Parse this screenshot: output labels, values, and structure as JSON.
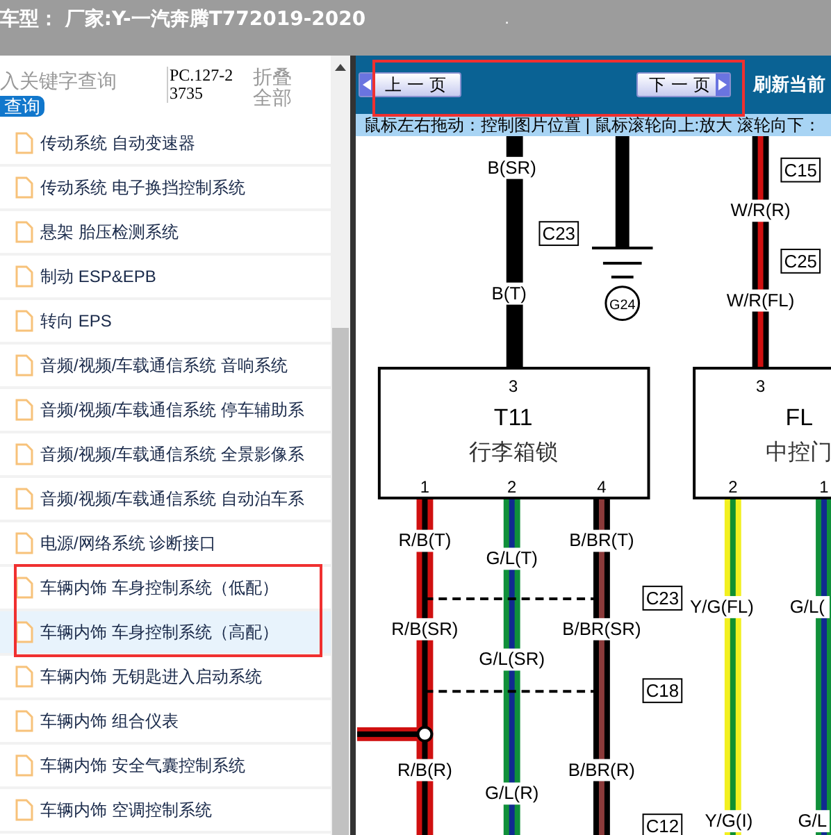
{
  "header": {
    "title": "车型： 厂家:Y-一汽奔腾T772019-2020",
    "mark": "."
  },
  "sidebar": {
    "search": {
      "placeholder": "入关键字查询"
    },
    "search_button": "查询",
    "code": "PC.127-23735",
    "collapse_all": "折叠全部",
    "items": [
      {
        "label": "传动系统 自动变速器",
        "selected": false
      },
      {
        "label": "传动系统 电子换挡控制系统",
        "selected": false
      },
      {
        "label": "悬架 胎压检测系统",
        "selected": false
      },
      {
        "label": "制动 ESP&EPB",
        "selected": false
      },
      {
        "label": "转向 EPS",
        "selected": false
      },
      {
        "label": "音频/视频/车载通信系统 音响系统",
        "selected": false
      },
      {
        "label": "音频/视频/车载通信系统 停车辅助系",
        "selected": false
      },
      {
        "label": "音频/视频/车载通信系统 全景影像系",
        "selected": false
      },
      {
        "label": "音频/视频/车载通信系统 自动泊车系",
        "selected": false
      },
      {
        "label": "电源/网络系统 诊断接口",
        "selected": false
      },
      {
        "label": "车辆内饰 车身控制系统（低配）",
        "selected": false
      },
      {
        "label": "车辆内饰 车身控制系统（高配）",
        "selected": true
      },
      {
        "label": "车辆内饰 无钥匙进入启动系统",
        "selected": false
      },
      {
        "label": "车辆内饰 组合仪表",
        "selected": false
      },
      {
        "label": "车辆内饰 安全气囊控制系统",
        "selected": false
      },
      {
        "label": "车辆内饰 空调控制系统",
        "selected": false
      }
    ]
  },
  "viewer": {
    "prev_button": "上一页",
    "next_button": "下一页",
    "refresh": "刷新当前",
    "hint": "鼠标左右拖动：控制图片位置 | 鼠标滚轮向上:放大  滚轮向下：",
    "diagram": {
      "wire_labels": [
        "B(SR)",
        "B(T)",
        "W/R(R)",
        "W/R(FL)",
        "R/B(T)",
        "G/L(T)",
        "B/BR(T)",
        "R/B(SR)",
        "G/L(SR)",
        "B/BR(SR)",
        "R/B(R)",
        "G/L(R)",
        "B/BR(R)",
        "Y/G(FL)",
        "G/L(",
        "Y/G(I)",
        "G/L"
      ],
      "connectors": [
        "C23",
        "C15",
        "C25",
        "C23",
        "C18",
        "C12"
      ],
      "ground": "G24",
      "components": [
        {
          "code": "T11",
          "name": "行李箱锁",
          "pins": [
            "3",
            "1",
            "2",
            "4"
          ]
        },
        {
          "code": "FL",
          "name": "中控门",
          "pins": [
            "3",
            "2",
            "1"
          ]
        }
      ]
    }
  }
}
